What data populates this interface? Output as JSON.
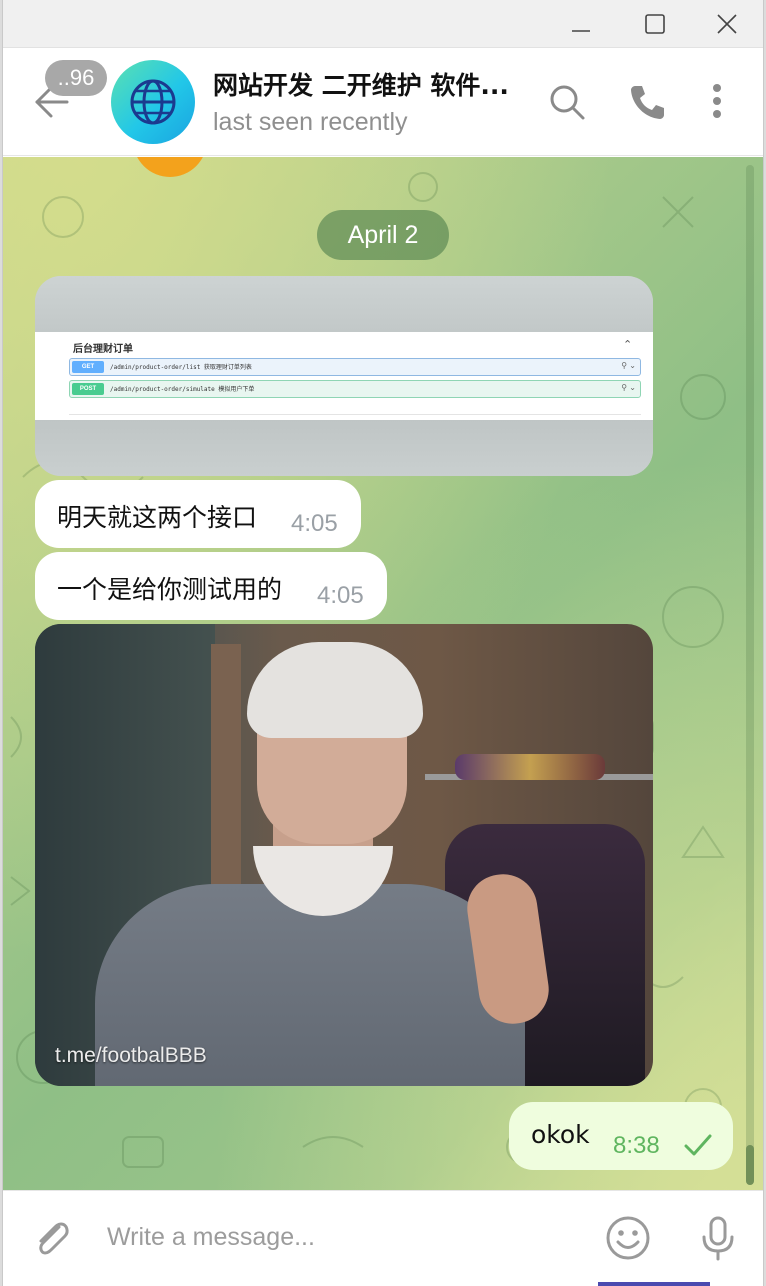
{
  "window": {
    "controls": [
      "minimize-icon",
      "maximize-icon",
      "close-icon"
    ]
  },
  "header": {
    "unread_count": "..96",
    "title": "网站开发 二开维护 软件...",
    "status": "last seen recently",
    "avatar_icon": "globe-icon",
    "actions": [
      "search-icon",
      "phone-icon",
      "more-vertical-icon"
    ]
  },
  "chat": {
    "date_label": "April 2",
    "photo": {
      "panel_title": "后台理财订单",
      "rows": [
        {
          "method": "GET",
          "path": "/admin/product-order/list  获取理财订单列表"
        },
        {
          "method": "POST",
          "path": "/admin/product-order/simulate  模拟用户下单"
        }
      ]
    },
    "messages": [
      {
        "text": "明天就这两个接口",
        "time": "4:05"
      },
      {
        "text": "一个是给你测试用的",
        "time": "4:05"
      }
    ],
    "gif_caption": "t.me/footbalBBB",
    "outgoing": {
      "text": "okok",
      "time": "8:38",
      "status_icon": "check-icon"
    }
  },
  "composer": {
    "placeholder": "Write a message...",
    "icons": [
      "paperclip-icon",
      "emoji-icon",
      "microphone-icon"
    ]
  },
  "colors": {
    "outgoing_bubble": "#effdde",
    "read_check": "#5fb55f",
    "date_pill": "#608c56"
  }
}
